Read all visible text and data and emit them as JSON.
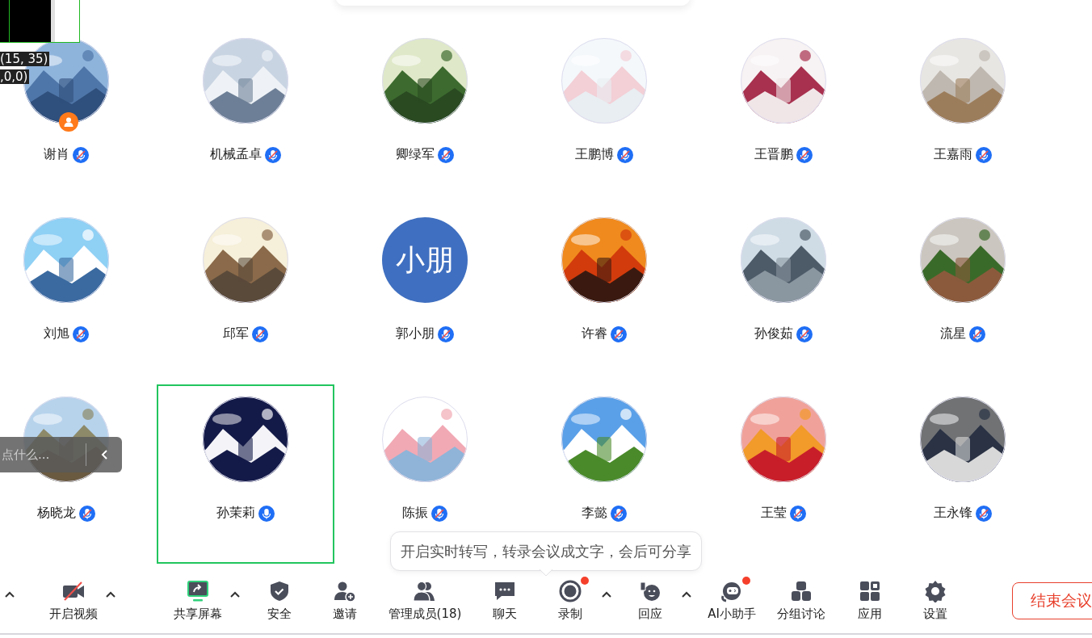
{
  "debug_overlay": {
    "lines": [
      "(15, 35)",
      ",0,0)"
    ]
  },
  "participants": [
    {
      "name": "谢肖",
      "muted": true,
      "host": true,
      "selected": false
    },
    {
      "name": "机械孟卓",
      "muted": true,
      "host": false,
      "selected": false
    },
    {
      "name": "卿绿军",
      "muted": true,
      "host": false,
      "selected": false
    },
    {
      "name": "王鹏博",
      "muted": true,
      "host": false,
      "selected": false
    },
    {
      "name": "王晋鹏",
      "muted": true,
      "host": false,
      "selected": false
    },
    {
      "name": "王嘉雨",
      "muted": true,
      "host": false,
      "selected": false
    },
    {
      "name": "刘旭",
      "muted": true,
      "host": false,
      "selected": false
    },
    {
      "name": "邱军",
      "muted": true,
      "host": false,
      "selected": false
    },
    {
      "name": "郭小朋",
      "muted": true,
      "host": false,
      "selected": false,
      "avatar": {
        "kind": "text",
        "text": "小朋",
        "color": "#3f6fc0"
      }
    },
    {
      "name": "许睿",
      "muted": true,
      "host": false,
      "selected": false
    },
    {
      "name": "孙俊茹",
      "muted": true,
      "host": false,
      "selected": false
    },
    {
      "name": "流星",
      "muted": true,
      "host": false,
      "selected": false
    },
    {
      "name": "杨晓龙",
      "muted": true,
      "host": false,
      "selected": false
    },
    {
      "name": "孙茉莉",
      "muted": false,
      "host": false,
      "selected": true
    },
    {
      "name": "陈振",
      "muted": true,
      "host": false,
      "selected": false
    },
    {
      "name": "李懿",
      "muted": true,
      "host": false,
      "selected": false
    },
    {
      "name": "王莹",
      "muted": true,
      "host": false,
      "selected": false
    },
    {
      "name": "王永锋",
      "muted": true,
      "host": false,
      "selected": false
    }
  ],
  "chat_input": {
    "placeholder": "点什么..."
  },
  "tooltip": "开启实时转写，转录会议成文字，会后可分享",
  "toolbar": [
    {
      "kind": "caret"
    },
    {
      "kind": "tool",
      "label": "开启视频",
      "off": true,
      "badge": false
    },
    {
      "kind": "caret"
    },
    {
      "kind": "tool",
      "label": "共享屏幕",
      "off": false,
      "badge": false
    },
    {
      "kind": "caret"
    },
    {
      "kind": "tool",
      "label": "安全",
      "off": false,
      "badge": false
    },
    {
      "kind": "tool",
      "label": "邀请",
      "off": false,
      "badge": false
    },
    {
      "kind": "tool",
      "label": "管理成员(18)",
      "off": false,
      "badge": false
    },
    {
      "kind": "tool",
      "label": "聊天",
      "off": false,
      "badge": false
    },
    {
      "kind": "tool",
      "label": "录制",
      "off": false,
      "badge": true
    },
    {
      "kind": "caret"
    },
    {
      "kind": "tool",
      "label": "回应",
      "off": false,
      "badge": false
    },
    {
      "kind": "caret"
    },
    {
      "kind": "tool",
      "label": "AI小助手",
      "off": false,
      "badge": true
    },
    {
      "kind": "tool",
      "label": "分组讨论",
      "off": false,
      "badge": false
    },
    {
      "kind": "tool",
      "label": "应用",
      "off": false,
      "badge": false
    },
    {
      "kind": "tool",
      "label": "设置",
      "off": false,
      "badge": false
    }
  ],
  "end_button": "结束会议"
}
